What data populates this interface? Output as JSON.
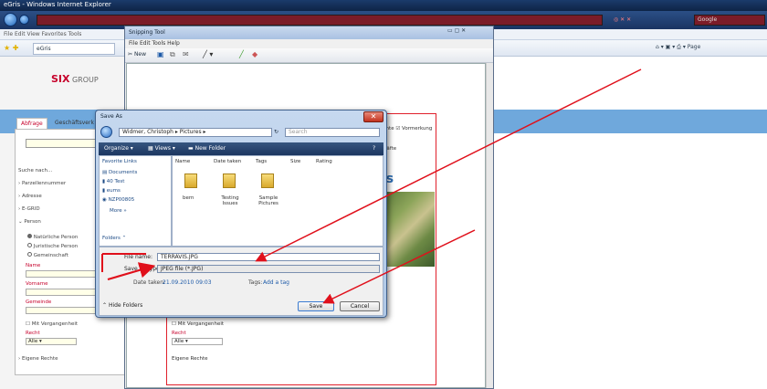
{
  "ie": {
    "title": "eGris - Windows Internet Explorer",
    "search_placeholder": "Google",
    "menu": "File  Edit  View  Favorites  Tools",
    "tab_label": "eGris",
    "tools": "Page"
  },
  "site": {
    "logo_main": "SIX",
    "logo_sub": "GROUP",
    "tab_query": "Abfrage",
    "tab_business": "Geschäftsverk",
    "search_label": "Suche nach...",
    "nav_parcel": "Parzellennummer",
    "nav_address": "Adresse",
    "nav_egrid": "E-GRID",
    "nav_person": "Person",
    "radio_natural": "Natürliche Person",
    "radio_legal": "Juristische Person",
    "radio_community": "Gemeinschaft",
    "label_name": "Name",
    "label_firstname": "Vorname",
    "label_municipality": "Gemeinde",
    "label_history": "Mit Vergangenheit",
    "label_right": "Recht",
    "select_all": "Alle",
    "nav_own_rights": "Eigene Rechte",
    "right_text1": "rechte",
    "right_text2": "Vormerkung",
    "right_text3": "schäfte",
    "big_text": "is"
  },
  "snip": {
    "title": "Snipping Tool",
    "menu": "File  Edit  Tools  Help",
    "new_label": "New",
    "inner_history": "Mit Vergangenheit",
    "inner_right": "Recht",
    "inner_all": "Alle",
    "inner_own": "Eigene Rechte"
  },
  "dialog": {
    "title": "Save As",
    "path": "Widmer, Christoph  ▸  Pictures  ▸",
    "search_placeholder": "Search",
    "organize": "Organize",
    "views": "Views",
    "new_folder": "New Folder",
    "fav_header": "Favorite Links",
    "fav_items": [
      "Documents",
      "40 Test",
      "eums",
      "NZP00805"
    ],
    "more": "More »",
    "folders": "Folders",
    "columns": [
      "Name",
      "Date taken",
      "Tags",
      "Size",
      "Rating"
    ],
    "files": [
      {
        "name": "bern"
      },
      {
        "name": "Testing Issues"
      },
      {
        "name": "Sample Pictures"
      }
    ],
    "filename_label": "File name:",
    "filename_value": "TERRAVIS.JPG",
    "savetype_label": "Save as type:",
    "savetype_value": "JPEG file (*.JPG)",
    "date_label": "Date taken:",
    "date_value": "21.09.2010 09:03",
    "tags_label": "Tags:",
    "tags_value": "Add a tag",
    "hide_folders": "Hide Folders",
    "save": "Save",
    "cancel": "Cancel"
  }
}
